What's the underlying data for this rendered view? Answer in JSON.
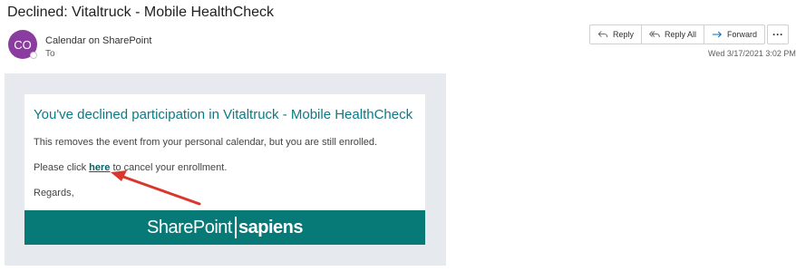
{
  "email": {
    "subject": "Declined: Vitaltruck - Mobile HealthCheck",
    "avatar_initials": "CO",
    "sender": "Calendar on SharePoint",
    "to_label": "To",
    "date": "Wed 3/17/2021 3:02 PM"
  },
  "actions": {
    "reply": "Reply",
    "reply_all": "Reply All",
    "forward": "Forward",
    "more": "···"
  },
  "message": {
    "heading": "You've declined participation in Vitaltruck - Mobile HealthCheck",
    "line1": "This removes the event from your personal calendar, but you are still enrolled.",
    "line2_pre": "Please click ",
    "line2_link": "here",
    "line2_post": " to cancel your enrollment.",
    "closing": "Regards,"
  },
  "banner": {
    "logo_left": "SharePoint",
    "logo_right": "sapiens"
  },
  "colors": {
    "accent": "#0b7a85",
    "banner": "#077a78",
    "avatar": "#8a3d9e",
    "arrow": "#d9362c"
  }
}
